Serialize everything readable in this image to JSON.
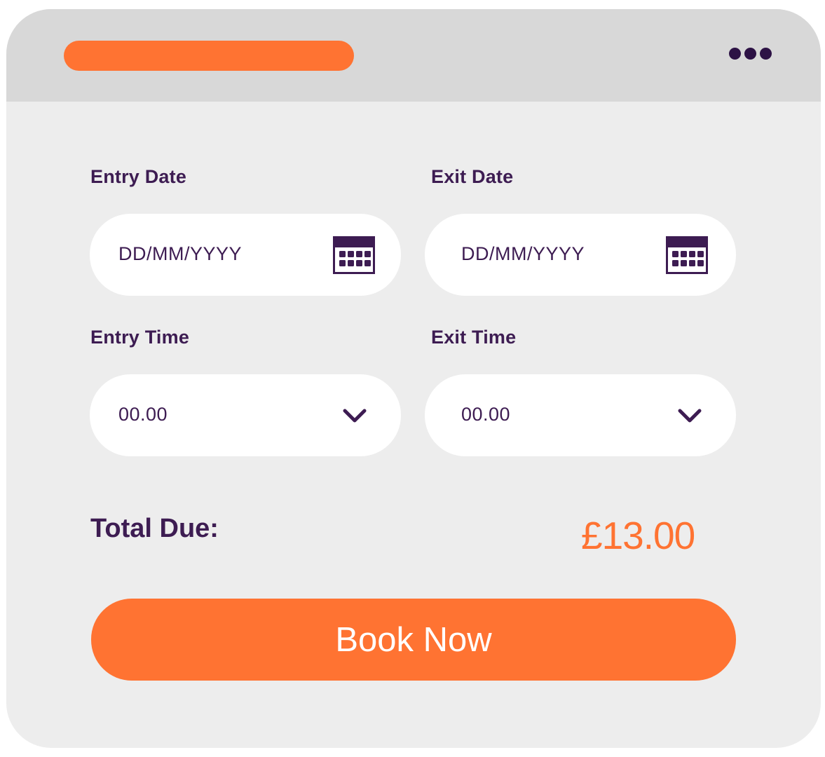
{
  "colors": {
    "accent": "#ff7332",
    "text_dark": "#3d1c52",
    "titlebar": "#d8d8d8",
    "panel": "#ededed",
    "field_bg": "#ffffff"
  },
  "titlebar": {
    "menu_icon": "more-dots-icon"
  },
  "form": {
    "entry_date": {
      "label": "Entry Date",
      "placeholder": "DD/MM/YYYY",
      "icon": "calendar-icon"
    },
    "exit_date": {
      "label": "Exit Date",
      "placeholder": "DD/MM/YYYY",
      "icon": "calendar-icon"
    },
    "entry_time": {
      "label": "Entry Time",
      "value": "00.00",
      "icon": "chevron-down-icon"
    },
    "exit_time": {
      "label": "Exit Time",
      "value": "00.00",
      "icon": "chevron-down-icon"
    }
  },
  "total": {
    "label": "Total Due:",
    "amount": "£13.00"
  },
  "book_button": {
    "label": "Book Now"
  }
}
